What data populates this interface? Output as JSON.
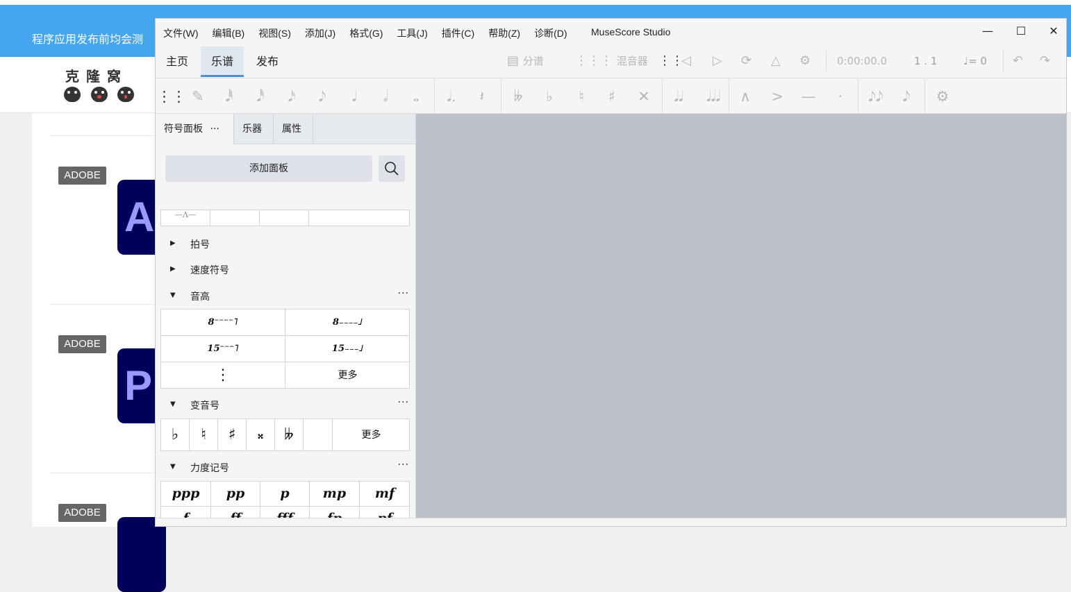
{
  "background_page": {
    "banner_text": "程序应用发布前均会测",
    "logo_text": "克隆窝",
    "tags": [
      "ADOBE",
      "ADOBE",
      "ADOBE"
    ],
    "app_letters": [
      "A",
      "P",
      ""
    ]
  },
  "window": {
    "menu": [
      "文件(W)",
      "编辑(B)",
      "视图(S)",
      "添加(J)",
      "格式(G)",
      "工具(J)",
      "插件(C)",
      "帮助(Z)",
      "诊断(D)"
    ],
    "app_title": "MuseScore Studio",
    "controls": [
      "minimize",
      "maximize",
      "close"
    ]
  },
  "main_tabs": [
    "主页",
    "乐谱",
    "发布"
  ],
  "playback": {
    "parts_label": "分谱",
    "mixer_label": "混音器",
    "time": "0:00:00.0",
    "measure": "1 . 1",
    "tempo": "= 0"
  },
  "panel": {
    "tabs": [
      "符号面板",
      "乐器",
      "属性"
    ],
    "tab_more": "···",
    "add_palette": "添加面板",
    "sections": {
      "time_sig": "拍号",
      "tempo": "速度符号",
      "pitch": "音高",
      "accidentals": "变音号",
      "dynamics": "力度记号"
    },
    "section_more": "···",
    "more_label": "更多",
    "pitch_items": [
      [
        "8⁻⁻⁻⁻˥",
        "8₋₋₋₋˩"
      ],
      [
        "15⁻⁻⁻˥",
        "15₋₋₋˩"
      ]
    ],
    "accidental_items": [
      "♭",
      "♮",
      "♯",
      "𝄪",
      "𝄫",
      ""
    ],
    "dynamics_items": [
      [
        "ppp",
        "pp",
        "p",
        "mp",
        "mf"
      ],
      [
        "f",
        "ff",
        "fff",
        "fp",
        "pf"
      ]
    ]
  },
  "colors": {
    "banner": "#45a5ee",
    "score_bg": "#bcc0ca",
    "accent": "#4a8fd6",
    "app_icon": "#00005b"
  }
}
